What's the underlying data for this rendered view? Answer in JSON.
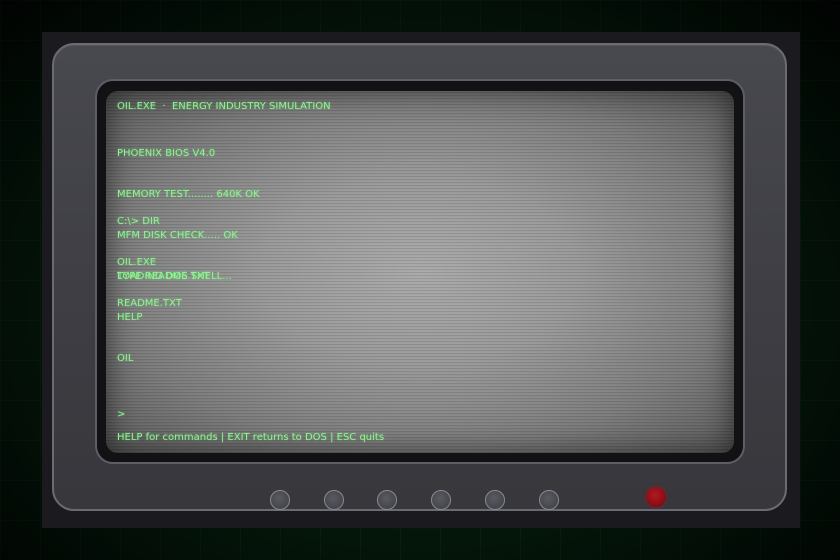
{
  "window": {
    "title_line": "OIL.EXE  ·  ENERGY INDUSTRY SIMULATION"
  },
  "terminal": {
    "boot_lines": [
      "PHOENIX BIOS V4.0",
      "MEMORY TEST........ 640K OK",
      "MFM DISK CHECK..... OK",
      "LOADING DOS SHELL..."
    ],
    "dir_lines": [
      "C:\\> DIR",
      "OIL.EXE",
      "README.TXT"
    ],
    "readme_lines": [
      "TYPE README.TXT",
      "HELP",
      "OIL"
    ],
    "prompt": ">",
    "status_bar": "HELP for commands | EXIT returns to DOS | ESC quits"
  },
  "monitor": {
    "knob_count": 6,
    "power_led_color": "#9a1019",
    "text_color": "#8df58f"
  }
}
